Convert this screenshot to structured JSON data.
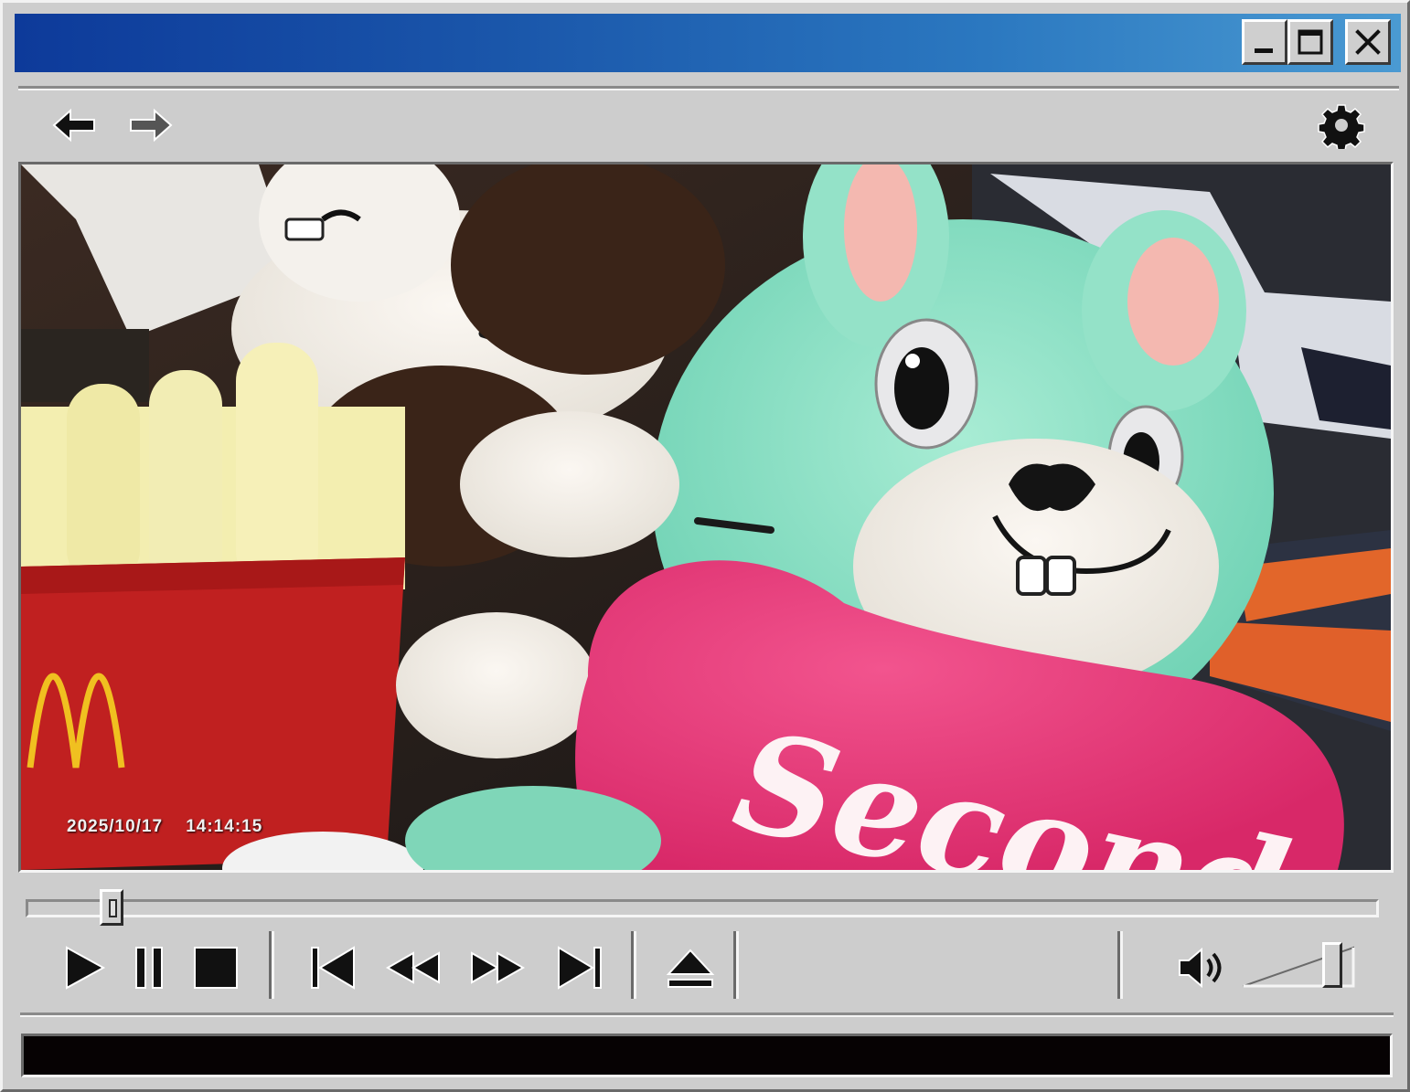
{
  "window": {
    "title": "",
    "controls": {
      "minimize_icon": "minimize-icon",
      "maximize_icon": "maximize-icon",
      "close_icon": "close-icon"
    },
    "colors": {
      "titlebar_start": "#0d3a9a",
      "titlebar_end": "#4a9ad2",
      "chrome": "#cdcdcd",
      "status_bar": "#060203"
    }
  },
  "toolbar": {
    "back_icon": "arrow-left-icon",
    "forward_icon": "arrow-right-icon",
    "settings_icon": "gear-icon"
  },
  "video": {
    "timestamp_date": "2025/10/17",
    "timestamp_time": "14:14:15",
    "overlay_text": "Second"
  },
  "playback": {
    "progress_fraction": 0.056,
    "buttons": [
      {
        "name": "play-button",
        "icon": "play-icon"
      },
      {
        "name": "pause-button",
        "icon": "pause-icon"
      },
      {
        "name": "stop-button",
        "icon": "stop-icon"
      },
      {
        "name": "previous-button",
        "icon": "skip-back-icon"
      },
      {
        "name": "rewind-button",
        "icon": "rewind-icon"
      },
      {
        "name": "fast-forward-button",
        "icon": "fast-forward-icon"
      },
      {
        "name": "next-button",
        "icon": "skip-forward-icon"
      },
      {
        "name": "eject-button",
        "icon": "eject-icon"
      }
    ],
    "volume_icon": "speaker-icon",
    "volume_fraction": 0.85
  },
  "status": {
    "text": ""
  }
}
